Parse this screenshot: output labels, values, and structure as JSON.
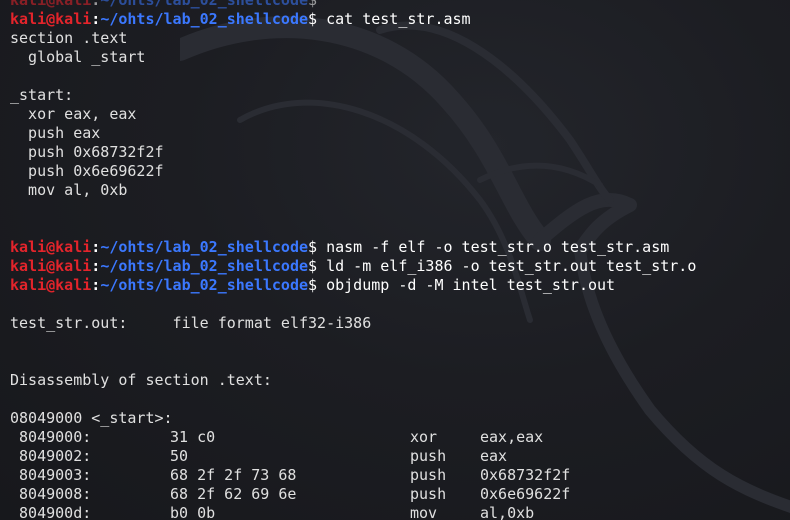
{
  "terminal": {
    "prompt": {
      "user_host": "kali@kali",
      "separator": ":",
      "path": "~/ohts/lab_02_shellcode",
      "sigil": "$ "
    },
    "colors": {
      "background": "#1c1d22",
      "prompt_host": "#e3242b",
      "prompt_path": "#3b78ff",
      "text": "#dcdcdc"
    },
    "commands": [
      "cat test_str.asm",
      "nasm -f elf -o test_str.o test_str.asm",
      "ld -m elf_i386 -o test_str.out test_str.o",
      "objdump -d -M intel test_str.out"
    ],
    "asm_source": [
      "section .text",
      "  global _start",
      "",
      "_start:",
      "  xor eax, eax",
      "  push eax",
      "  push 0x68732f2f",
      "  push 0x6e69622f",
      "  mov al, 0xb"
    ],
    "objdump": {
      "file_line": "test_str.out:     file format elf32-i386",
      "section_line": "Disassembly of section .text:",
      "symbol_line": "08049000 <_start>:",
      "rows": [
        {
          "addr": " 8049000:",
          "bytes": "31 c0",
          "op": "xor",
          "args": "eax,eax"
        },
        {
          "addr": " 8049002:",
          "bytes": "50",
          "op": "push",
          "args": "eax"
        },
        {
          "addr": " 8049003:",
          "bytes": "68 2f 2f 73 68",
          "op": "push",
          "args": "0x68732f2f"
        },
        {
          "addr": " 8049008:",
          "bytes": "68 2f 62 69 6e",
          "op": "push",
          "args": "0x6e69622f"
        },
        {
          "addr": " 804900d:",
          "bytes": "b0 0b",
          "op": "mov",
          "args": "al,0xb"
        }
      ]
    },
    "watermark_icon": "kali-dragon-icon"
  }
}
